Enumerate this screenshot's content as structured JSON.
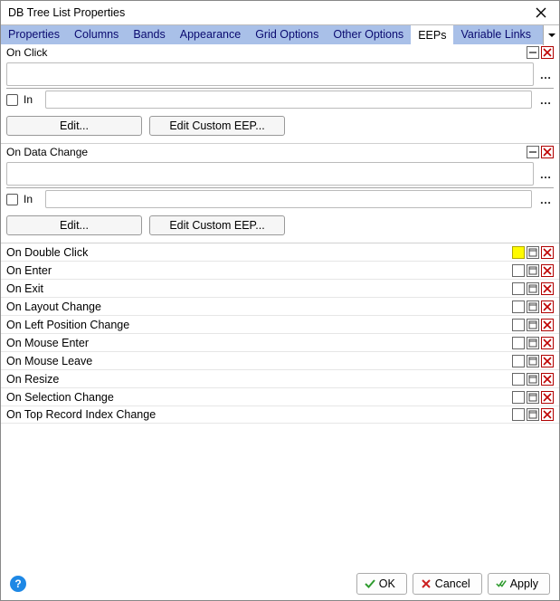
{
  "window": {
    "title": "DB Tree List Properties"
  },
  "tabs": [
    "Properties",
    "Columns",
    "Bands",
    "Appearance",
    "Grid Options",
    "Other Options",
    "EEPs",
    "Variable Links"
  ],
  "activeTab": "EEPs",
  "sections": {
    "onClick": {
      "label": "On Click",
      "inLabel": "In"
    },
    "onDataChange": {
      "label": "On Data Change",
      "inLabel": "In"
    }
  },
  "buttons": {
    "edit": "Edit...",
    "editCustom": "Edit Custom EEP..."
  },
  "rows": [
    "On Double Click",
    "On Enter",
    "On Exit",
    "On Layout Change",
    "On Left Position Change",
    "On Mouse Enter",
    "On Mouse Leave",
    "On Resize",
    "On Selection Change",
    "On Top Record Index Change"
  ],
  "footer": {
    "ok": "OK",
    "cancel": "Cancel",
    "apply": "Apply"
  }
}
